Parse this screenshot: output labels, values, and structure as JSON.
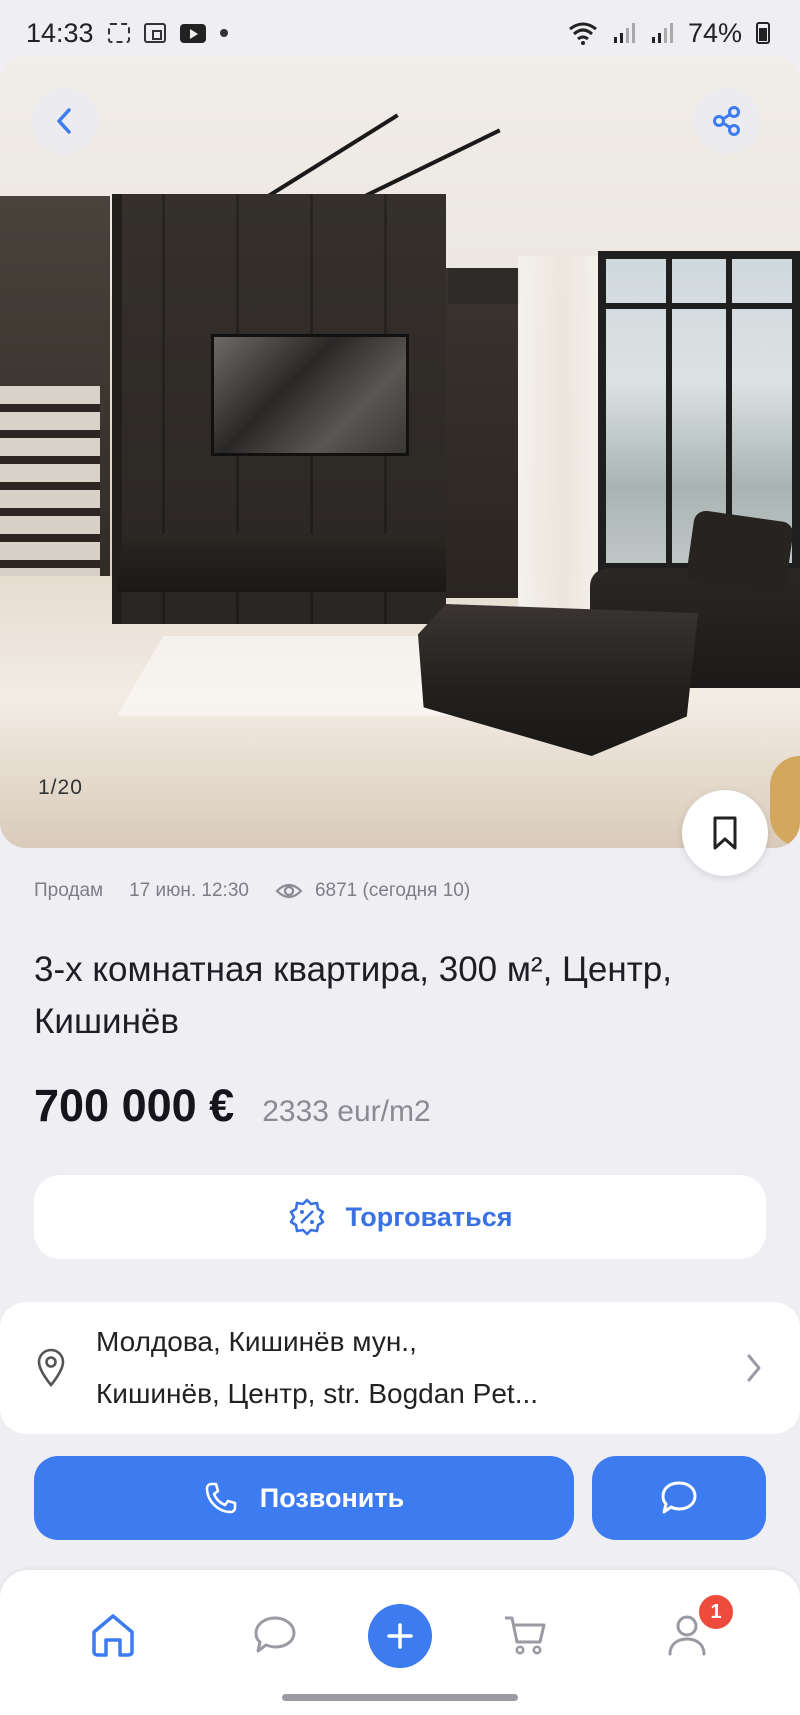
{
  "status_bar": {
    "time": "14:33",
    "battery": "74%"
  },
  "gallery": {
    "counter": "1/20"
  },
  "listing": {
    "type": "Продам",
    "date": "17 июн. 12:30",
    "views": "6871 (сегодня 10)",
    "title": "3-х комнатная квартира, 300 м², Центр, Кишинёв",
    "price": "700 000 €",
    "price_per_m2": "2333 eur/m2"
  },
  "bargain": {
    "label": "Торговаться"
  },
  "address": {
    "line1": "Молдова, Кишинёв мун.,",
    "line2": "Кишинёв, Центр, str. Bogdan Pet..."
  },
  "actions": {
    "call_label": "Позвонить"
  },
  "tabbar": {
    "profile_badge": "1"
  },
  "colors": {
    "accent": "#3d7bf0",
    "badge": "#ef4b3c",
    "background": "#eeeef3"
  },
  "icons": [
    "back-icon",
    "share-icon",
    "bookmark-icon",
    "eye-icon",
    "discount-icon",
    "location-pin-icon",
    "chevron-right-icon",
    "phone-icon",
    "chat-icon",
    "home-icon",
    "plus-icon",
    "cart-icon",
    "profile-icon"
  ]
}
